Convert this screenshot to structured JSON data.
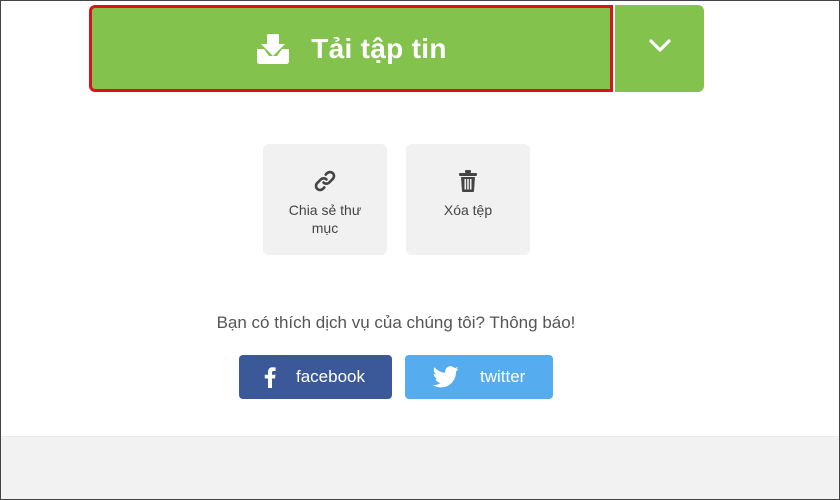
{
  "download": {
    "label": "Tải tập tin",
    "icon": "download-tray-icon",
    "dropdown_icon": "chevron-down-icon",
    "color": "#83c24c",
    "highlight_border": "#d8141b"
  },
  "actions": [
    {
      "label": "Chia sẻ thư mục",
      "icon": "link-icon"
    },
    {
      "label": "Xóa tệp",
      "icon": "trash-icon"
    }
  ],
  "social": {
    "prompt": "Bạn có thích dịch vụ của chúng tôi? Thông báo!",
    "facebook": {
      "label": "facebook",
      "icon": "facebook-icon",
      "color": "#3b5998"
    },
    "twitter": {
      "label": "twitter",
      "icon": "twitter-bird-icon",
      "color": "#55acee"
    }
  }
}
